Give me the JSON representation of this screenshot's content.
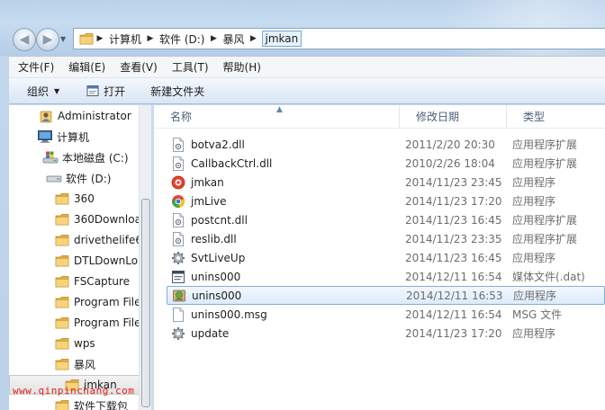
{
  "address": {
    "crumbs": [
      "计算机",
      "软件 (D:)",
      "暴风",
      "jmkan"
    ]
  },
  "menu": [
    "文件(F)",
    "编辑(E)",
    "查看(V)",
    "工具(T)",
    "帮助(H)"
  ],
  "toolbar": {
    "organize": "组织",
    "open": "打开",
    "new_folder": "新建文件夹"
  },
  "nav": [
    {
      "label": "Administrator",
      "icon": "user-folder-icon"
    },
    {
      "label": "计算机",
      "icon": "computer-icon"
    },
    {
      "label": "本地磁盘 (C:)",
      "icon": "windows-drive-icon"
    },
    {
      "label": "软件 (D:)",
      "icon": "drive-icon"
    },
    {
      "label": "360",
      "icon": "folder-icon"
    },
    {
      "label": "360Downloa",
      "icon": "folder-icon"
    },
    {
      "label": "drivethelife6",
      "icon": "folder-icon"
    },
    {
      "label": "DTLDownLo",
      "icon": "folder-icon"
    },
    {
      "label": "FSCapture",
      "icon": "folder-icon"
    },
    {
      "label": "Program File",
      "icon": "folder-icon"
    },
    {
      "label": "Program File",
      "icon": "folder-icon"
    },
    {
      "label": "wps",
      "icon": "folder-icon"
    },
    {
      "label": "暴风",
      "icon": "folder-icon"
    },
    {
      "label": "jmkan",
      "icon": "folder-icon"
    },
    {
      "label": "软件下载包",
      "icon": "folder-icon"
    }
  ],
  "columns": {
    "name": "名称",
    "date": "修改日期",
    "type": "类型"
  },
  "files": [
    {
      "name": "botva2.dll",
      "date": "2011/2/20 20:30",
      "type": "应用程序扩展",
      "icon": "dll-file-icon"
    },
    {
      "name": "CallbackCtrl.dll",
      "date": "2010/2/26 18:04",
      "type": "应用程序扩展",
      "icon": "dll-file-icon"
    },
    {
      "name": "jmkan",
      "date": "2014/11/23 23:45",
      "type": "应用程序",
      "icon": "jmkan-app-icon"
    },
    {
      "name": "jmLive",
      "date": "2014/11/23 17:20",
      "type": "应用程序",
      "icon": "chrome-app-icon"
    },
    {
      "name": "postcnt.dll",
      "date": "2014/11/23 16:45",
      "type": "应用程序扩展",
      "icon": "dll-file-icon"
    },
    {
      "name": "reslib.dll",
      "date": "2014/11/23 23:35",
      "type": "应用程序扩展",
      "icon": "dll-file-icon"
    },
    {
      "name": "SvtLiveUp",
      "date": "2014/11/23 16:45",
      "type": "应用程序",
      "icon": "gear-app-icon"
    },
    {
      "name": "unins000",
      "date": "2014/12/11 16:54",
      "type": "媒体文件(.dat)",
      "icon": "dat-file-icon"
    },
    {
      "name": "unins000",
      "date": "2014/12/11 16:53",
      "type": "应用程序",
      "icon": "uninstaller-icon"
    },
    {
      "name": "unins000.msg",
      "date": "2014/12/11 16:54",
      "type": "MSG 文件",
      "icon": "blank-file-icon"
    },
    {
      "name": "update",
      "date": "2014/11/23 17:20",
      "type": "应用程序",
      "icon": "gear-app-icon"
    }
  ],
  "watermark": "www.qinpinchang.com"
}
